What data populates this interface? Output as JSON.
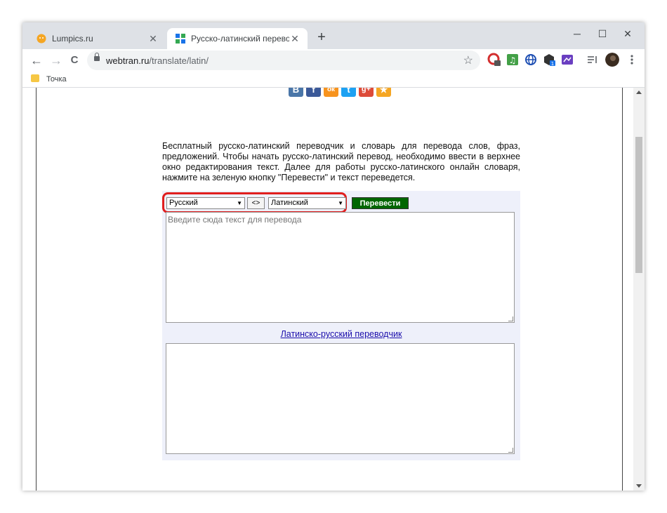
{
  "browser": {
    "tabs": [
      {
        "title": "Lumpics.ru",
        "active": false
      },
      {
        "title": "Русско-латинский переводчик",
        "active": true
      }
    ],
    "new_tab": "+",
    "window_controls": {
      "minimize": "─",
      "maximize": "☐",
      "close": "✕"
    },
    "nav": {
      "back": "←",
      "forward": "→",
      "reload": "C"
    },
    "address": {
      "domain": "webtran.ru",
      "path": "/translate/latin/"
    },
    "bookmark_star": "☆",
    "bookmarks": [
      {
        "label": "Точка"
      }
    ],
    "extensions": [
      {
        "name": "opera-icon",
        "color": "#d32f2f",
        "badge": "3"
      },
      {
        "name": "music-icon",
        "color": "#43a047"
      },
      {
        "name": "globe-icon",
        "color": "#1e4fb3"
      },
      {
        "name": "package-icon",
        "color": "#333333",
        "badge": "1"
      },
      {
        "name": "ext-purple-icon",
        "color": "#6a3fc1"
      },
      {
        "name": "playlist-icon",
        "color": "#5f6368"
      },
      {
        "name": "profile-avatar",
        "color": "#3a2c20"
      },
      {
        "name": "menu-icon",
        "color": "#5f6368"
      }
    ]
  },
  "page": {
    "social": [
      {
        "name": "vk",
        "glyph": "В",
        "color": "#4a76a8"
      },
      {
        "name": "facebook",
        "glyph": "f",
        "color": "#3b5998"
      },
      {
        "name": "odnoklassniki",
        "glyph": "ок",
        "color": "#f7931e"
      },
      {
        "name": "twitter",
        "glyph": "t",
        "color": "#1da1f2"
      },
      {
        "name": "google-plus",
        "glyph": "g+",
        "color": "#dd4b39"
      },
      {
        "name": "favorite",
        "glyph": "★",
        "color": "#f5a623"
      }
    ],
    "intro_text": "Бесплатный русско-латинский переводчик и словарь для перевода слов, фраз, предложений. Чтобы начать русско-латинский перевод, необходимо ввести в верхнее окно редактирования текст. Далее для работы русско-латинского онлайн словаря, нажмите на зеленую кнопку \"Перевести\" и текст переведется.",
    "source_language": "Русский",
    "swap_label": "<>",
    "target_language": "Латинский",
    "translate_button": "Перевести",
    "input_placeholder": "Введите сюда текст для перевода",
    "reverse_link": "Латинско-русский переводчик",
    "output_value": ""
  },
  "colors": {
    "highlight": "#e01e1e",
    "translate_button": "#006600",
    "panel_background": "#eef0fa"
  }
}
